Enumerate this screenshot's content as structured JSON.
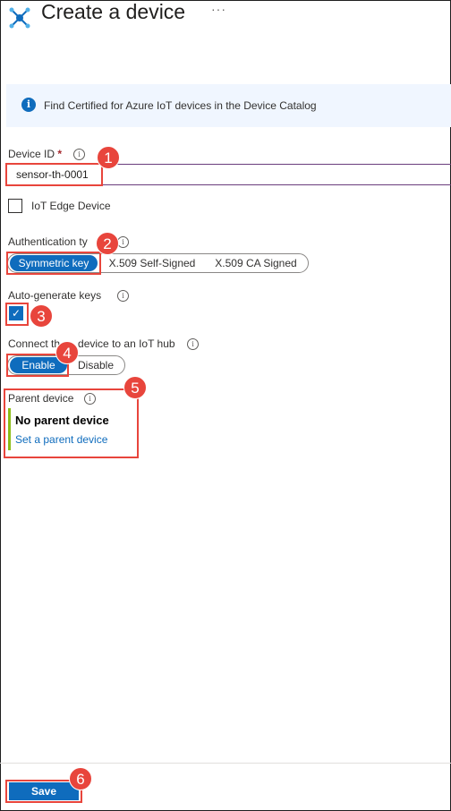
{
  "header": {
    "title": "Create a device",
    "more": "···",
    "icon": "iot-hub-icon"
  },
  "banner": {
    "text": "Find Certified for Azure IoT devices in the Device Catalog",
    "icon": "info-icon"
  },
  "device_id": {
    "label": "Device ID",
    "required_mark": "*",
    "value": "sensor-th-0001"
  },
  "iot_edge": {
    "label": "IoT Edge Device",
    "checked": false
  },
  "authentication": {
    "label": "Authentication ty",
    "options": [
      "Symmetric key",
      "X.509 Self-Signed",
      "X.509 CA Signed"
    ],
    "selected": "Symmetric key"
  },
  "auto_generate": {
    "label": "Auto-generate keys",
    "checked": true,
    "check_glyph": "✓"
  },
  "connect": {
    "label_start": "Connect th",
    "label_end": "device to an IoT hub",
    "options": [
      "Enable",
      "Disable"
    ],
    "selected": "Enable"
  },
  "parent": {
    "label": "Parent device",
    "value": "No parent device",
    "link": "Set a parent device"
  },
  "footer": {
    "save_label": "Save"
  },
  "callouts": [
    "1",
    "2",
    "3",
    "4",
    "5",
    "6"
  ],
  "colors": {
    "accent": "#0f6cbd",
    "callout": "#e8453c",
    "parent_bar": "#8cbd18",
    "focus_border": "#6a3d7c"
  }
}
